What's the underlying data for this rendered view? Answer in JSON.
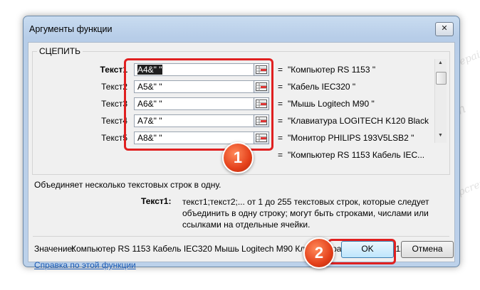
{
  "watermark": "Soringpcrepair.com",
  "dialog": {
    "title": "Аргументы функции",
    "close_label": "✕",
    "function_name": "СЦЕПИТЬ"
  },
  "arguments": [
    {
      "label": "Текст1",
      "value": "A4&\" \"",
      "result": "\"Компьютер RS 1153 \""
    },
    {
      "label": "Текст2",
      "value": "A5&\" \"",
      "result": "\"Кабель IEC320 \""
    },
    {
      "label": "Текст3",
      "value": "A6&\" \"",
      "result": "\"Мышь Logitech M90 \""
    },
    {
      "label": "Текст4",
      "value": "A7&\" \"",
      "result": "\"Клавиатура LOGITECH K120 Black ...\""
    },
    {
      "label": "Текст5",
      "value": "A8&\" \"",
      "result": "\"Монитор PHILIPS 193V5LSB2 \""
    }
  ],
  "equals": "=",
  "total_result": "\"Компьютер RS 1153 Кабель IEC...",
  "description": "Объединяет несколько текстовых строк в одну.",
  "arg_help": {
    "label": "Текст1:",
    "text": "текст1;текст2;... от 1 до 255 текстовых строк, которые следует объединить в одну строку; могут быть строками, числами или ссылками на отдельные ячейки."
  },
  "value": {
    "label": "Значение:",
    "text": "Компьютер RS 1153 Кабель IEC320 Мышь Logitech M90 Клавиатура LOGITECH K120 Black USB Монит..."
  },
  "help_link": "Справка по этой функции",
  "buttons": {
    "ok": "OK",
    "cancel": "Отмена"
  },
  "badges": {
    "one": "1",
    "two": "2"
  },
  "colors": {
    "highlight": "#e02020",
    "badge": "#e4401a",
    "link": "#1b5bb5"
  }
}
